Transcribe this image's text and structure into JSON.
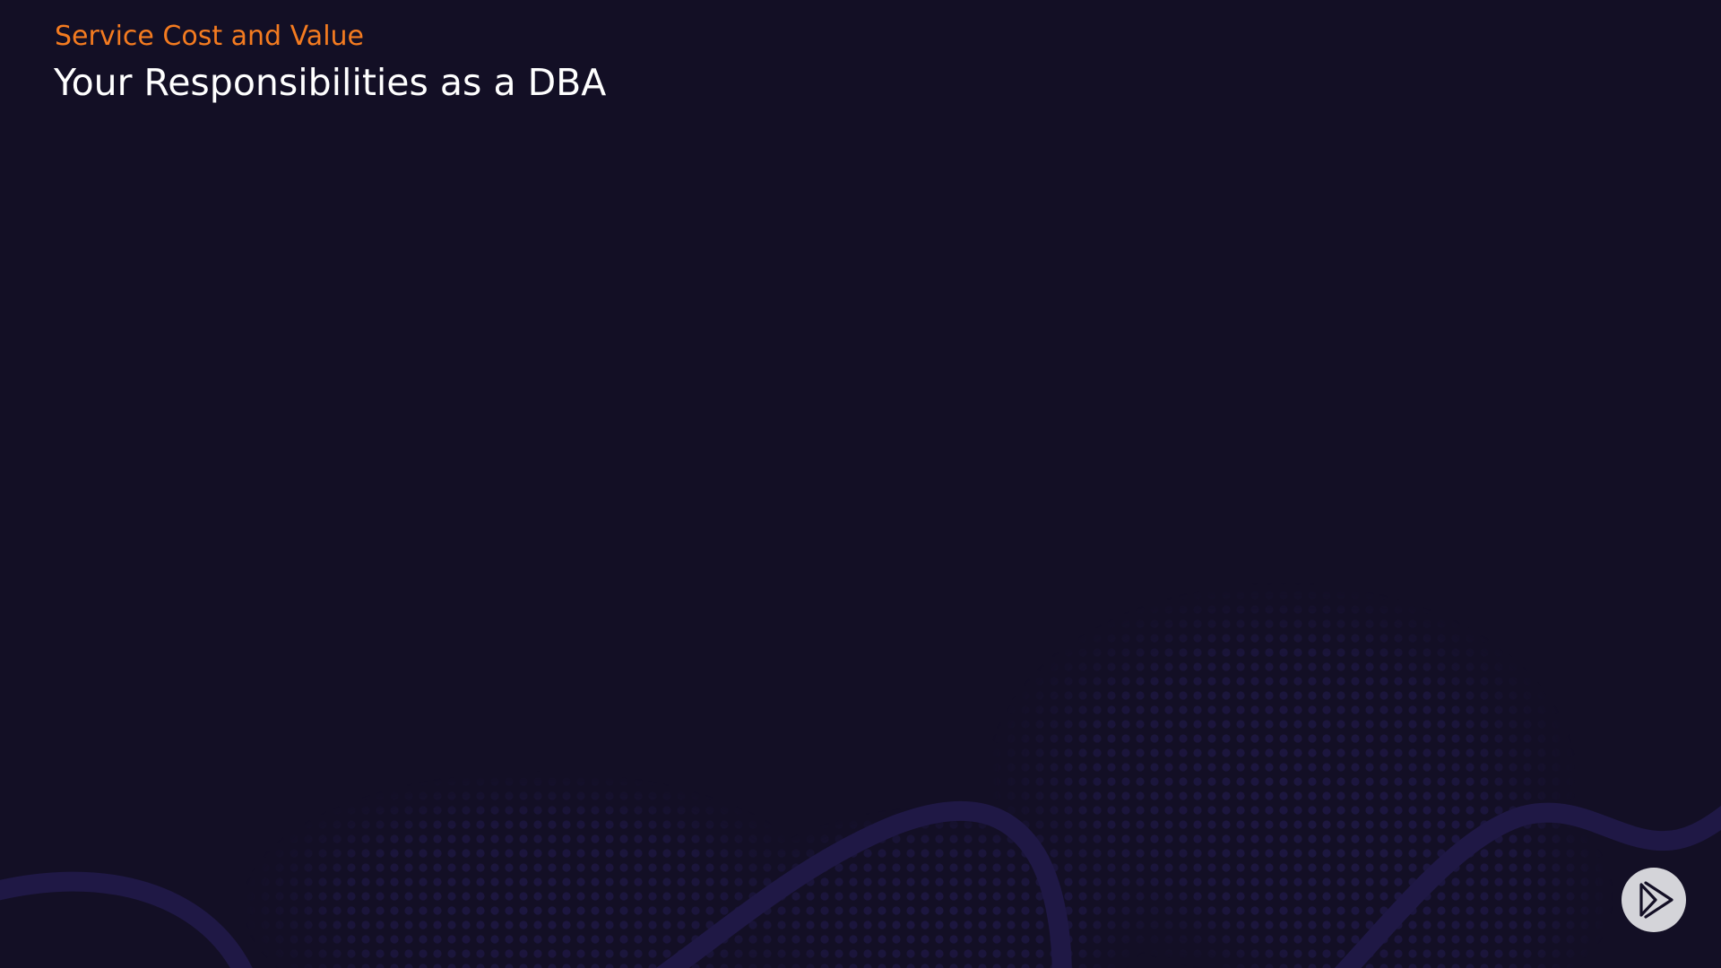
{
  "slide": {
    "section_label": "Service Cost and Value",
    "title": "Your Responsibilities as a DBA"
  },
  "colors": {
    "background": "#130f25",
    "section_label": "#f47b20",
    "title": "#ffffff",
    "wave_line": "#1f1845",
    "dot_pattern": "#1d1740",
    "player_button": "#d4d4d9",
    "player_icon": "#130f25"
  },
  "controls": {
    "player_icon": "play-logo-icon"
  }
}
